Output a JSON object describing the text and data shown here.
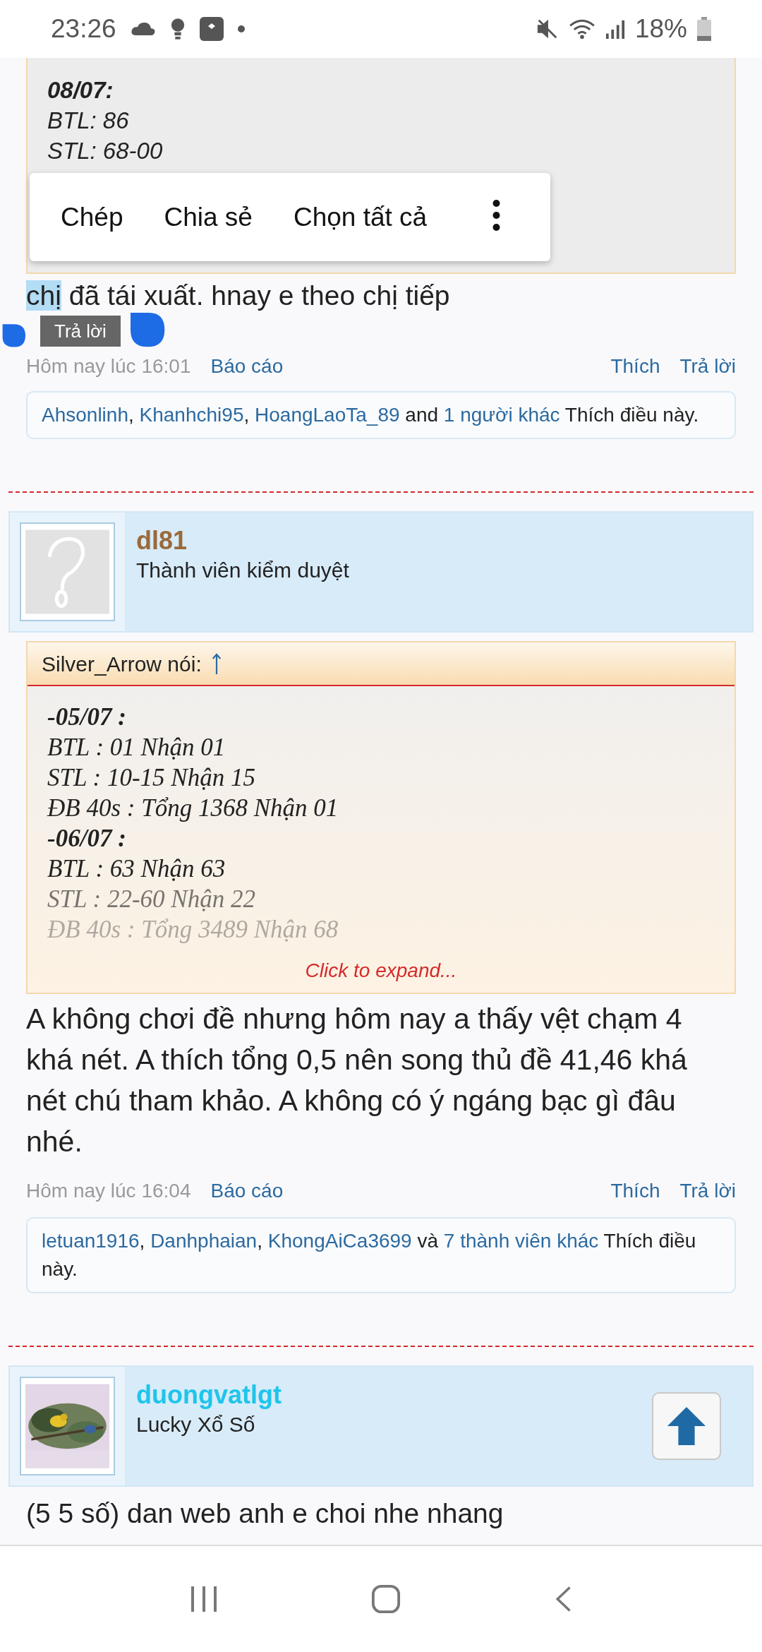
{
  "status_bar": {
    "time": "23:26",
    "battery": "18%"
  },
  "quote_top": {
    "lines": [
      {
        "kind": "date",
        "text": "08/07:"
      },
      {
        "kind": "line",
        "text": "BTL: 86"
      },
      {
        "kind": "line",
        "text": "STL: 68-00"
      }
    ]
  },
  "selection_menu": {
    "items": [
      "Chép",
      "Chia sẻ",
      "Chọn tất cả"
    ]
  },
  "post_1": {
    "selected_text": "chị",
    "text": " đã tái xuất. hnay e theo chị tiếp",
    "tooltip": "Trả lời",
    "time": "Hôm nay lúc 16:01",
    "report": "Báo cáo",
    "like": "Thích",
    "reply": "Trả lời",
    "likes": {
      "users": [
        "Ahsonlinh",
        "Khanhchi95",
        "HoangLaoTa_89"
      ],
      "separator": ",",
      "joiner": "and",
      "others": "1 người khác",
      "suffix": "Thích điều này."
    }
  },
  "post_2": {
    "user": {
      "name": "dl81",
      "title": "Thành viên kiểm duyệt",
      "avatar": {
        "kind": "placeholder"
      }
    },
    "quote": {
      "author": "Silver_Arrow nói:",
      "lines": [
        {
          "kind": "date",
          "text": "-05/07 :"
        },
        {
          "kind": "line",
          "text": "BTL : 01 Nhận 01"
        },
        {
          "kind": "line",
          "text": "STL : 10-15 Nhận 15"
        },
        {
          "kind": "line",
          "text": "ĐB 40s : Tổng 1368 Nhận 01"
        },
        {
          "kind": "date",
          "text": "-06/07 :"
        },
        {
          "kind": "line",
          "text": "BTL : 63 Nhận 63"
        },
        {
          "kind": "line",
          "text": "STL : 22-60 Nhận 22"
        },
        {
          "kind": "line",
          "text": "ĐB 40s : Tổng 3489 Nhận 68"
        }
      ],
      "expand": "Click to expand..."
    },
    "text": "A không chơi đề nhưng hôm nay a thấy vệt chạm 4 khá nét. A thích tổng 0,5 nên song thủ đề 41,46 khá nét chú tham khảo. A không có ý ngáng bạc gì đâu nhé.",
    "time": "Hôm nay lúc 16:04",
    "report": "Báo cáo",
    "like": "Thích",
    "reply": "Trả lời",
    "likes": {
      "users": [
        "letuan1916",
        "Danhphaian",
        "KhongAiCa3699"
      ],
      "separator": ",",
      "joiner": "và",
      "others": "7 thành viên khác",
      "suffix": "Thích điều này."
    }
  },
  "post_3": {
    "user": {
      "name": "duongvatlgt",
      "title": "Lucky Xổ Số"
    },
    "text": "(5 5 số) dan web anh e choi nhe nhang"
  }
}
